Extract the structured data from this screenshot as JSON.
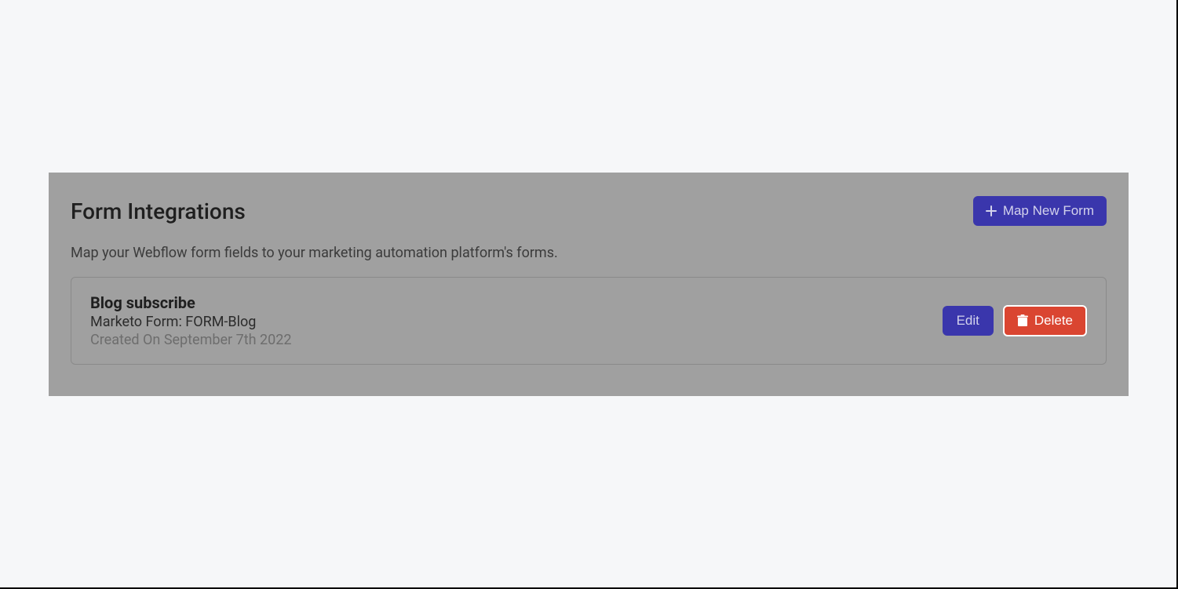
{
  "header": {
    "title": "Form Integrations",
    "map_new_form_label": "Map New Form"
  },
  "description": "Map your Webflow form fields to your marketing automation platform's forms.",
  "forms": [
    {
      "title": "Blog subscribe",
      "subtitle": "Marketo Form: FORM-Blog",
      "created": "Created On September 7th 2022",
      "edit_label": "Edit",
      "delete_label": "Delete"
    }
  ]
}
